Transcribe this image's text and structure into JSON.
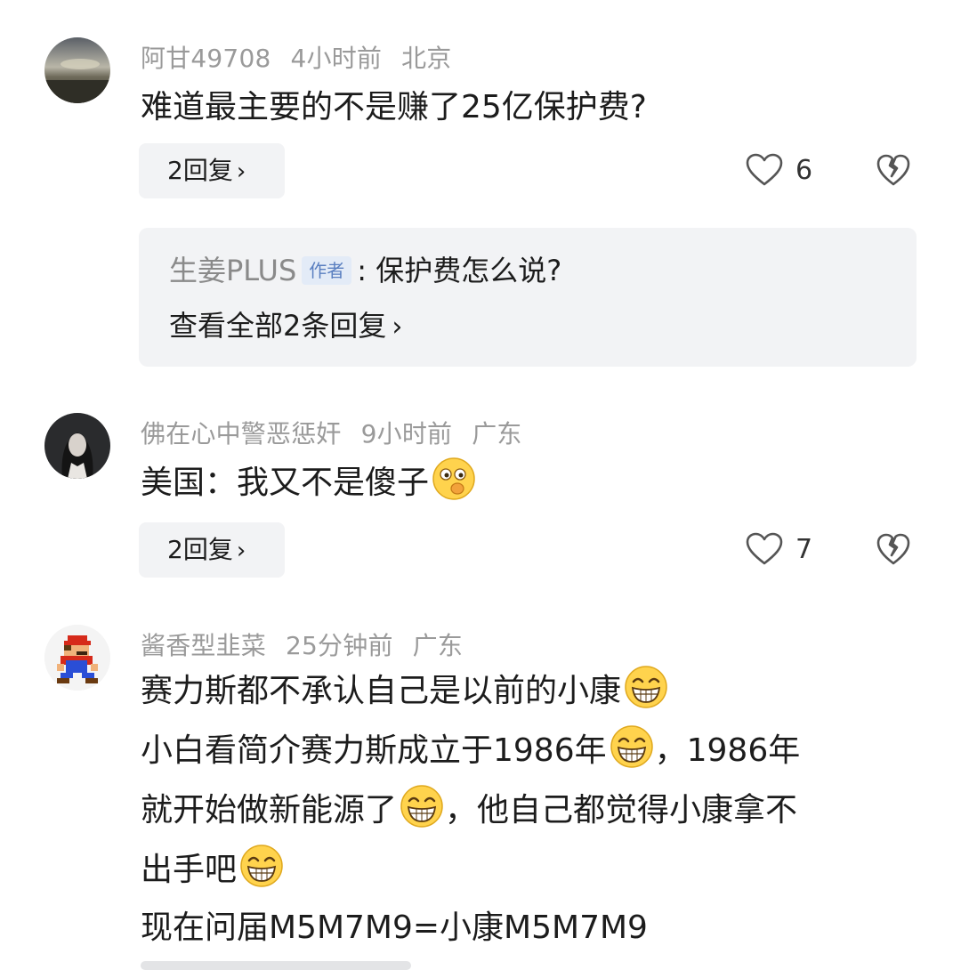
{
  "comments": [
    {
      "username": "阿甘49708",
      "time": "4小时前",
      "location": "北京",
      "text": "难道最主要的不是赚了25亿保护费?",
      "replies_label": "2回复",
      "likes": "6",
      "sub_reply": {
        "author": "生姜PLUS",
        "badge": "作者",
        "text": ": 保护费怎么说?",
        "view_all": "查看全部2条回复"
      }
    },
    {
      "username": "佛在心中警恶惩奸",
      "time": "9小时前",
      "location": "广东",
      "text": "美国：我又不是傻子",
      "replies_label": "2回复",
      "likes": "7"
    },
    {
      "username": "酱香型韭菜",
      "time": "25分钟前",
      "location": "广东",
      "lines": [
        "赛力斯都不承认自己是以前的小康",
        "小白看简介赛力斯成立于1986年",
        "，1986年",
        "就开始做新能源了",
        "，他自己都觉得小康拿不",
        "出手吧",
        "现在问届M5M7M9=小康M5M7M9"
      ]
    }
  ],
  "icons": {
    "like": "heart-outline-icon",
    "dislike": "broken-heart-icon",
    "chevron": "chevron-right-icon",
    "emoji_thinking": "thinking-face-emoji",
    "emoji_grin": "grinning-face-emoji"
  },
  "colors": {
    "meta": "#9a9a9a",
    "text": "#1c1c1c",
    "reply_bg": "#f2f3f5",
    "author_badge": "#5a7fc0"
  }
}
